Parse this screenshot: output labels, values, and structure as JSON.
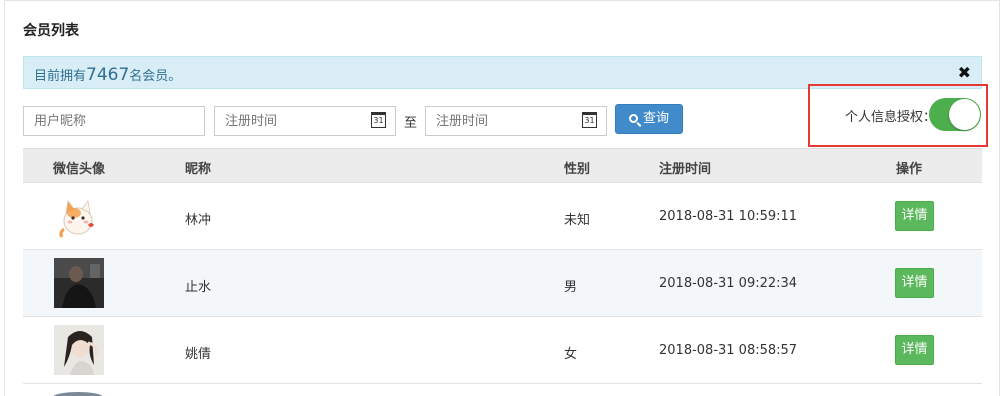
{
  "page": {
    "title": "会员列表"
  },
  "alert": {
    "prefix": "目前拥有",
    "count": "7467",
    "suffix": "名会员。",
    "close_symbol": "✖"
  },
  "filters": {
    "nickname_placeholder": "用户昵称",
    "date_start_placeholder": "注册时间",
    "date_end_placeholder": "注册时间",
    "to_label": "至",
    "calendar_glyph": "31",
    "search_label": "查询"
  },
  "auth": {
    "label": "个人信息授权：",
    "enabled": true
  },
  "table": {
    "headers": {
      "avatar": "微信头像",
      "nickname": "昵称",
      "gender": "性别",
      "reg_time": "注册时间",
      "action": "操作"
    },
    "rows": [
      {
        "nickname": "林冲",
        "gender": "未知",
        "reg_time": "2018-08-31 10:59:11",
        "action": "详情",
        "avatar": "cartoon-cat-avatar"
      },
      {
        "nickname": "止水",
        "gender": "男",
        "reg_time": "2018-08-31 09:22:34",
        "action": "详情",
        "avatar": "dark-photo-avatar"
      },
      {
        "nickname": "姚倩",
        "gender": "女",
        "reg_time": "2018-08-31 08:58:57",
        "action": "详情",
        "avatar": "girl-photo-avatar"
      }
    ]
  },
  "colors": {
    "alert_bg": "#d9edf7",
    "primary": "#428bca",
    "success": "#5cb85c",
    "highlight": "#e53935"
  }
}
